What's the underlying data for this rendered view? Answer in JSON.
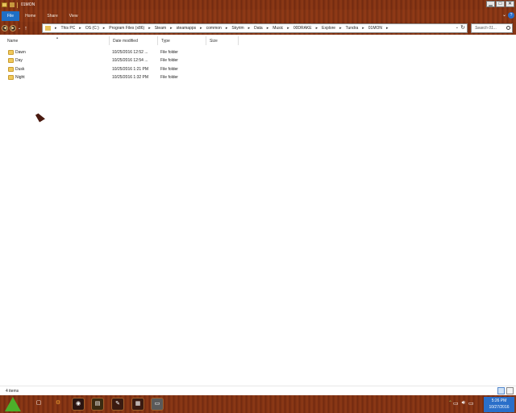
{
  "window": {
    "title": "01MON",
    "controls": {
      "minimize": "▁",
      "maximize": "□",
      "close": "✕"
    }
  },
  "ribbon": {
    "tabs": [
      {
        "label": "File"
      },
      {
        "label": "Home"
      },
      {
        "label": "Share"
      },
      {
        "label": "View"
      }
    ],
    "help": "?"
  },
  "address": {
    "breadcrumbs": [
      "This PC",
      "OS (C:)",
      "Program Files (x86)",
      "Steam",
      "steamapps",
      "common",
      "Skyrim",
      "Data",
      "Music",
      "00DRAKE",
      "Explore",
      "Tundra",
      "01MON"
    ],
    "search_placeholder": "Search 01..."
  },
  "columns": {
    "name": "Name",
    "date": "Date modified",
    "type": "Type",
    "size": "Size"
  },
  "files": [
    {
      "name": "Dawn",
      "date": "10/25/2016 12:52 ...",
      "type": "File folder"
    },
    {
      "name": "Day",
      "date": "10/25/2016 12:54 ...",
      "type": "File folder"
    },
    {
      "name": "Dusk",
      "date": "10/25/2016 1:21 PM",
      "type": "File folder"
    },
    {
      "name": "Night",
      "date": "10/25/2016 1:32 PM",
      "type": "File folder"
    }
  ],
  "status": {
    "item_count": "4 items"
  },
  "taskbar": {
    "apps": [
      {
        "icon": "task-view-icon"
      },
      {
        "icon": "firefox-icon"
      },
      {
        "icon": "file-explorer-icon"
      },
      {
        "icon": "tool-icon"
      },
      {
        "icon": "store-icon"
      },
      {
        "icon": "monitor-icon"
      }
    ],
    "clock": {
      "time": "5:26 PM",
      "date": "10/27/2016"
    }
  },
  "colors": {
    "accent": "#1f6fc5",
    "chrome": "#8e3a16",
    "folder": "#f0c85a"
  }
}
